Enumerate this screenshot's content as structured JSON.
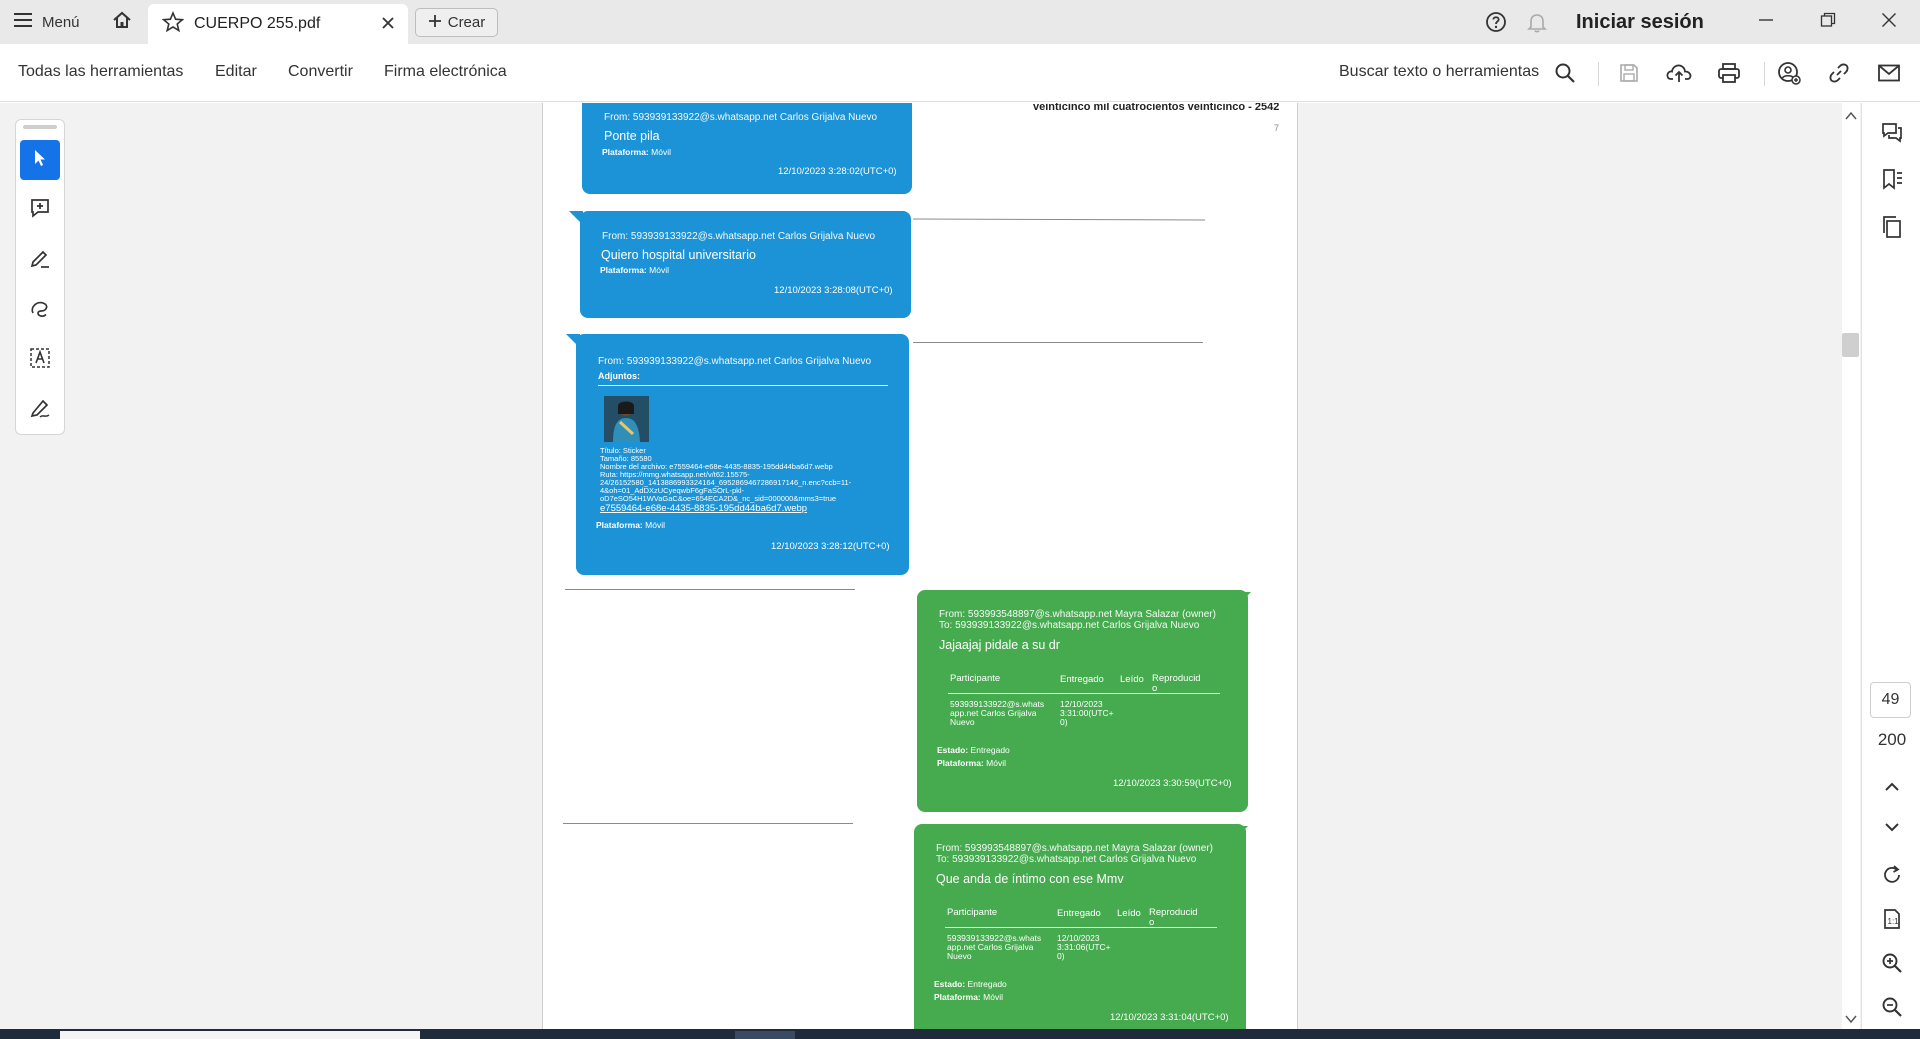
{
  "tabbar": {
    "menu_label": "Menú",
    "tab_title": "CUERPO 255.pdf",
    "create_label": "Crear",
    "signin_label": "Iniciar sesión"
  },
  "toolbar": {
    "items": [
      "Todas las herramientas",
      "Editar",
      "Convertir",
      "Firma electrónica"
    ],
    "search_label": "Buscar texto o herramientas"
  },
  "page_nav": {
    "current": "49",
    "total": "200"
  },
  "document": {
    "header_fragment": "veinticinco mil cuatrocientos veinticinco - 2542",
    "header_mark": "7",
    "messages": [
      {
        "from": "From: 593939133922@s.whatsapp.net Carlos Grijalva Nuevo",
        "text": "Ponte pila",
        "platform_label": "Plataforma:",
        "platform_value": "Móvil",
        "date": "12/10/2023 3:28:02(UTC+0)"
      },
      {
        "from": "From: 593939133922@s.whatsapp.net Carlos Grijalva Nuevo",
        "text": "Quiero hospital universitario",
        "platform_label": "Plataforma:",
        "platform_value": "Móvil",
        "date": "12/10/2023 3:28:08(UTC+0)"
      },
      {
        "from": "From: 593939133922@s.whatsapp.net Carlos Grijalva Nuevo",
        "attachments_label": "Adjuntos:",
        "attachment_lines": [
          "Título: Sticker",
          "Tamaño: 85580",
          "Nombre del archivo: e7559464-e68e-4435-8835-195dd44ba6d7.webp",
          "Ruta: https://mmg.whatsapp.net/v/t62.15575-",
          "24/26152580_1413886993324164_6952869467286917146_n.enc?ccb=11-",
          "4&oh=01_AdDXzUCyeqwbF6gFaSOrL-pkl-",
          "oD7eSO54H1WVaGaC&oe=654ECA2D&_nc_sid=000000&mms3=true"
        ],
        "attachment_link": "e7559464-e68e-4435-8835-195dd44ba6d7.webp",
        "platform_label": "Plataforma:",
        "platform_value": "Móvil",
        "date": "12/10/2023 3:28:12(UTC+0)"
      },
      {
        "from": "From: 593993548897@s.whatsapp.net Mayra Salazar (owner)",
        "to": "To: 593939133922@s.whatsapp.net Carlos Grijalva Nuevo",
        "text": "Jajaajaj pidale a su dr",
        "table_headers": [
          "Participante",
          "Entregado",
          "Leído",
          "Reproducid\no"
        ],
        "table_row": [
          "593939133922@s.whats\napp.net Carlos Grijalva\nNuevo",
          "12/10/2023\n3:31:00(UTC+\n0)",
          "",
          ""
        ],
        "state_label": "Estado:",
        "state_value": "Entregado",
        "platform_label": "Plataforma:",
        "platform_value": "Móvil",
        "date": "12/10/2023 3:30:59(UTC+0)"
      },
      {
        "from": "From: 593993548897@s.whatsapp.net Mayra Salazar (owner)",
        "to": "To: 593939133922@s.whatsapp.net Carlos Grijalva Nuevo",
        "text": "Que anda de íntimo con ese Mmv",
        "table_headers": [
          "Participante",
          "Entregado",
          "Leído",
          "Reproducid\no"
        ],
        "table_row": [
          "593939133922@s.whats\napp.net Carlos Grijalva\nNuevo",
          "12/10/2023\n3:31:06(UTC+\n0)",
          "",
          ""
        ],
        "state_label": "Estado:",
        "state_value": "Entregado",
        "platform_label": "Plataforma:",
        "platform_value": "Móvil",
        "date": "12/10/2023 3:31:04(UTC+0)"
      }
    ]
  },
  "colors": {
    "accent": "#1473e6",
    "bubble_blue": "#1c93d6",
    "bubble_green": "#45ab4e"
  }
}
